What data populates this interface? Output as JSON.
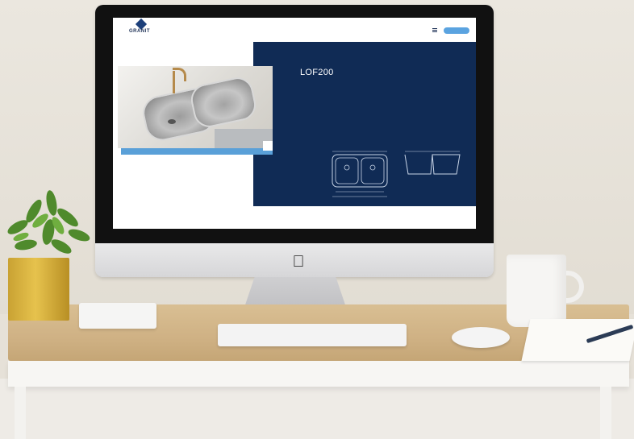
{
  "scene": {
    "description_colors": {
      "brand_navy": "#102b55",
      "accent_blue": "#5aa0d8",
      "desk_wood": "#cfb184",
      "pot_gold": "#d9b43f"
    }
  },
  "website": {
    "logo_text": "GRANIT",
    "nav": {
      "links": [
        "",
        "",
        "",
        "",
        ""
      ],
      "contact_button": ""
    },
    "breadcrumb": "",
    "product_title": "LOF200",
    "description_1": "",
    "description_2": "",
    "download_link": "",
    "diagram_labels": {
      "top_width": "",
      "side_width": ""
    }
  }
}
